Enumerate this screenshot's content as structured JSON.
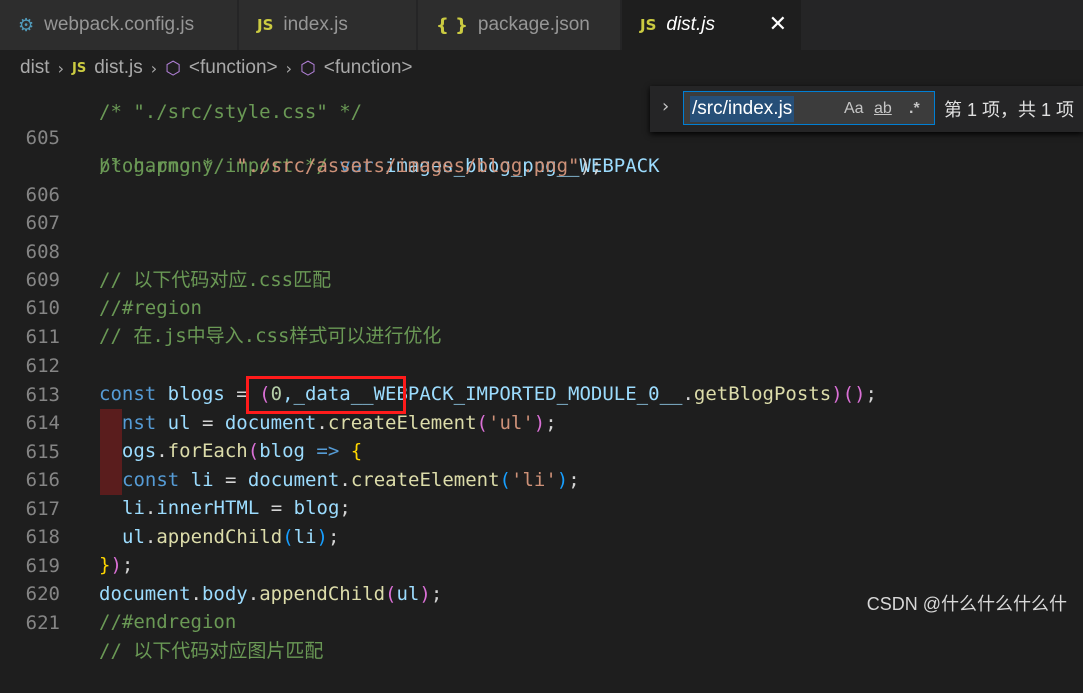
{
  "tabs": [
    {
      "icon": "gear",
      "label": "webpack.config.js"
    },
    {
      "icon": "js",
      "label": "index.js"
    },
    {
      "icon": "braces",
      "label": "package.json"
    },
    {
      "icon": "js",
      "label": "dist.js"
    }
  ],
  "icons": {
    "js": "JS",
    "braces": "{ }",
    "gear": "⚙",
    "close": "✕",
    "chevron": "›",
    "cube": "⬡"
  },
  "breadcrumb": {
    "items": [
      "dist",
      "dist.js",
      "<function>",
      "<function>"
    ]
  },
  "find": {
    "value": "/src/index.js",
    "match_case": "Aa",
    "whole_word": "ab",
    "regex": ".*",
    "result": "第 1 项，共 1 项"
  },
  "code": {
    "partial_top": "/* \"./src/style.css\" */",
    "l605_a": "/* harmony import */ ",
    "l605_b": "var",
    "l605_c": " images_blog_png__WEBPACK",
    "l605_d": "blog.png */ ",
    "l605_e": "\"./src/assets/images/blog.png\"",
    "l605_f": ");",
    "l608": "// 以下代码对应.css匹配",
    "l609": "//#region",
    "l610": "// 在.js中导入.css样式可以进行优化",
    "l612_const": "const",
    "l612_blogs": " blogs",
    "l612_eq": " = ",
    "l612_open": "(",
    "l612_zero": "0",
    "l612_mod": ",_data__WEBPACK_IMPORTED_MODULE_0__",
    "l612_dot": ".",
    "l612_fn": "getBlogPosts",
    "l612_close": ")",
    "l612_call": "()",
    "l612_semi": ";",
    "l613_const": "const",
    "l613_ul": " ul",
    "l613_eq": " = ",
    "l613_doc": "document",
    "l613_dot": ".",
    "l613_fn": "createElement",
    "l613_open": "(",
    "l613_str": "'ul'",
    "l613_close": ")",
    "l613_semi": ";",
    "l614_blogs": "blogs",
    "l614_dot": ".",
    "l614_fn": "forEach",
    "l614_open": "(",
    "l614_blog": "blog",
    "l614_arrow": " => ",
    "l614_brace": "{",
    "l615_const": "const",
    "l615_li": " li",
    "l615_eq": " = ",
    "l615_doc": "document",
    "l615_dot": ".",
    "l615_fn": "createElement",
    "l615_open": "(",
    "l615_str": "'li'",
    "l615_close": ")",
    "l615_semi": ";",
    "l616_li": "li",
    "l616_dot": ".",
    "l616_prop": "innerHTML",
    "l616_eq": " = ",
    "l616_blog": "blog",
    "l616_semi": ";",
    "l617_ul": "ul",
    "l617_dot": ".",
    "l617_fn": "appendChild",
    "l617_open": "(",
    "l617_li": "li",
    "l617_close": ")",
    "l617_semi": ";",
    "l618_brace": "}",
    "l618_paren": ")",
    "l618_semi": ";",
    "l619_doc": "document",
    "l619_dot": ".",
    "l619_body": "body",
    "l619_dot2": ".",
    "l619_fn": "appendChild",
    "l619_open": "(",
    "l619_ul": "ul",
    "l619_close": ")",
    "l619_semi": ";",
    "l620": "//#endregion",
    "l622_partial": "// 以下代码对应图片匹配"
  },
  "line_numbers": [
    "605",
    "606",
    "607",
    "608",
    "609",
    "610",
    "611",
    "612",
    "613",
    "614",
    "615",
    "616",
    "617",
    "618",
    "619",
    "620",
    "621"
  ],
  "watermark": "CSDN @什么什么什么什"
}
